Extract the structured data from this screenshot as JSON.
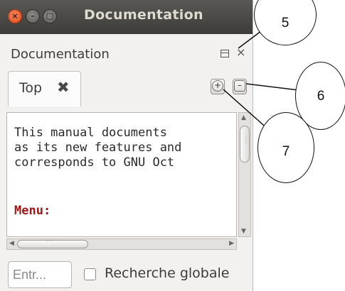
{
  "window": {
    "title": "Documentation",
    "controls": {
      "close": "×",
      "minimize": "–",
      "maximize": "□"
    }
  },
  "dock": {
    "title": "Documentation",
    "close_glyph": "×"
  },
  "tabs": [
    {
      "label": "Top",
      "close_glyph": "✖"
    }
  ],
  "zoom": {
    "in_glyph": "+",
    "out_glyph": "–"
  },
  "content": {
    "lines": [
      "This manual documents ",
      "as its new features and",
      "corresponds to GNU Oct"
    ],
    "menu_label": "Menu:"
  },
  "search": {
    "placeholder": "Entr...",
    "global_search_label": "Recherche globale",
    "global_search_checked": false
  },
  "annotations": [
    "5",
    "6",
    "7"
  ],
  "colors": {
    "titlebar": "#3d3c38",
    "close_button": "#df4b16",
    "menu_text": "#9e1616",
    "window_bg": "#f2f1f0"
  }
}
